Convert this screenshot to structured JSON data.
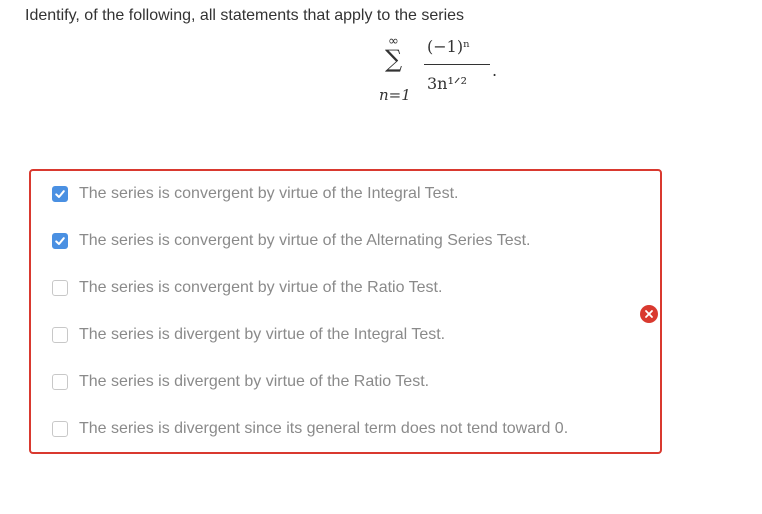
{
  "question": {
    "prompt": "Identify, of the following, all statements that apply to the series",
    "formula": {
      "sigma": "∑",
      "upper": "∞",
      "lower": "n=1",
      "numerator": "(−1)ⁿ",
      "denominator": "3n¹ᐟ²",
      "terminator": "."
    }
  },
  "options": [
    {
      "label": "The series is convergent by virtue of the Integral Test.",
      "checked": true
    },
    {
      "label": "The series is convergent by virtue of the Alternating Series Test.",
      "checked": true
    },
    {
      "label": "The series is convergent by virtue of the Ratio Test.",
      "checked": false
    },
    {
      "label": "The series is divergent by virtue of the Integral Test.",
      "checked": false
    },
    {
      "label": "The series is divergent by virtue of the Ratio Test.",
      "checked": false
    },
    {
      "label": "The series is divergent since its general term does not tend toward 0.",
      "checked": false
    }
  ],
  "status": {
    "icon": "error-x-icon",
    "border_color": "#d9392f",
    "check_color": "#4a90e2"
  }
}
